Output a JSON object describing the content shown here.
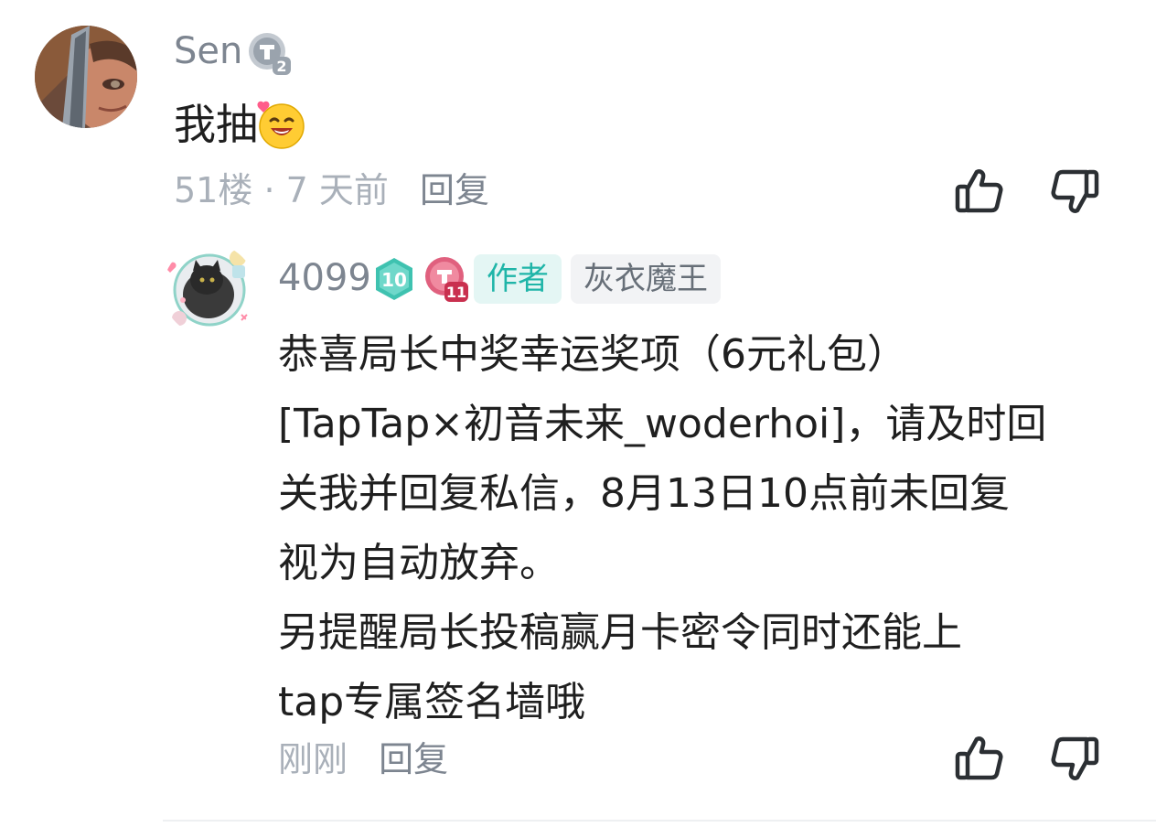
{
  "main_comment": {
    "username": "Sen",
    "badge_label": "2",
    "text": "我抽",
    "floor": "51楼",
    "separator": "·",
    "time": "7 天前",
    "reply_label": "回复"
  },
  "reply": {
    "username": "4099",
    "badge_level_1": "10",
    "badge_level_2": "11",
    "author_tag": "作者",
    "title_tag": "灰衣魔王",
    "lines": [
      "恭喜局长中奖幸运奖项（6元礼包）",
      "[TapTap×初音未来_woderhoi]，请及时回",
      "关我并回复私信，8月13日10点前未回复",
      "视为自动放弃。",
      "另提醒局长投稿赢月卡密令同时还能上",
      "tap专属签名墙哦"
    ],
    "time": "刚刚",
    "reply_label": "回复"
  },
  "icons": {
    "like": "thumbs-up-icon",
    "dislike": "thumbs-down-icon",
    "emoji": "smiling-face-with-heart-emoji"
  },
  "colors": {
    "accent": "#1fb5a8",
    "muted": "#a9b0b9",
    "username": "#7d8590"
  }
}
